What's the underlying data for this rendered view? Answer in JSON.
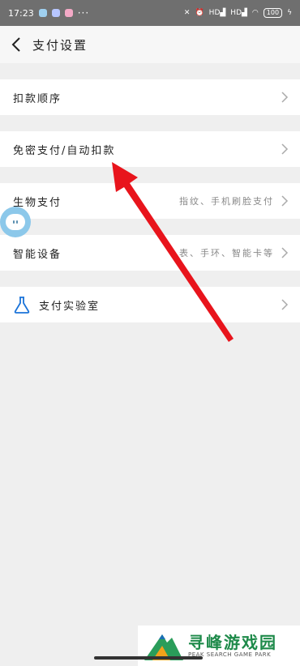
{
  "status_bar": {
    "time": "17:23",
    "dots": "···",
    "net1": "HD",
    "net2": "HD",
    "battery": "100"
  },
  "header": {
    "title": "支付设置"
  },
  "rows": [
    {
      "label": "扣款顺序",
      "sub": ""
    },
    {
      "label": "免密支付/自动扣款",
      "sub": ""
    },
    {
      "label": "生物支付",
      "sub": "指纹、手机刷脸支付"
    },
    {
      "label": "智能设备",
      "sub": "表、手环、智能卡等"
    },
    {
      "label": "支付实验室",
      "sub": ""
    }
  ],
  "watermark": {
    "cn": "寻峰游戏园",
    "en": "PEAK SEARCH GAME PARK"
  },
  "colors": {
    "arrow": "#e8141c",
    "watermark_green": "#1e8a4a",
    "bubble": "#8cc8ea"
  }
}
